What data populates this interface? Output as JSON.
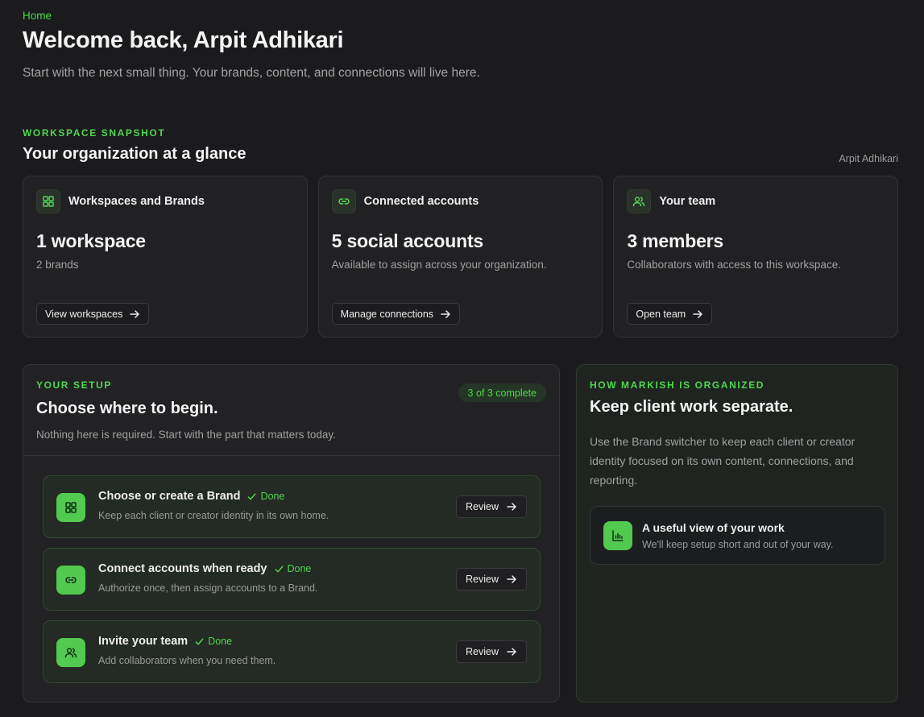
{
  "breadcrumb": "Home",
  "welcome": "Welcome back, Arpit Adhikari",
  "intro": "Start with the next small thing. Your brands, content, and connections will live here.",
  "snapshot": {
    "eyebrow": "WORKSPACE SNAPSHOT",
    "title": "Your organization at a glance",
    "user": "Arpit Adhikari",
    "cards": [
      {
        "label": "Workspaces and Brands",
        "value": "1 workspace",
        "sub": "2 brands",
        "button": "View workspaces",
        "icon": "grid-icon"
      },
      {
        "label": "Connected accounts",
        "value": "5 social accounts",
        "sub": "Available to assign across your organization.",
        "button": "Manage connections",
        "icon": "link-icon"
      },
      {
        "label": "Your team",
        "value": "3 members",
        "sub": "Collaborators with access to this workspace.",
        "button": "Open team",
        "icon": "users-icon"
      }
    ]
  },
  "setup": {
    "eyebrow": "YOUR SETUP",
    "badge": "3 of 3 complete",
    "title": "Choose where to begin.",
    "sub": "Nothing here is required. Start with the part that matters today.",
    "steps": [
      {
        "title": "Choose or create a Brand",
        "status": "Done",
        "desc": "Keep each client or creator identity in its own home.",
        "button": "Review",
        "icon": "grid-icon"
      },
      {
        "title": "Connect accounts when ready",
        "status": "Done",
        "desc": "Authorize once, then assign accounts to a Brand.",
        "button": "Review",
        "icon": "link-icon"
      },
      {
        "title": "Invite your team",
        "status": "Done",
        "desc": "Add collaborators when you need them.",
        "button": "Review",
        "icon": "users-icon"
      }
    ]
  },
  "org": {
    "eyebrow": "HOW MARKISH IS ORGANIZED",
    "title": "Keep client work separate.",
    "desc": "Use the Brand switcher to keep each client or creator identity focused on its own content, connections, and reporting.",
    "card": {
      "title": "A useful view of your work",
      "sub": "We'll keep setup short and out of your way.",
      "icon": "bar-chart-icon"
    }
  },
  "colors": {
    "accent": "#4fd64f",
    "background": "#1b1b1d",
    "card": "#212123"
  }
}
